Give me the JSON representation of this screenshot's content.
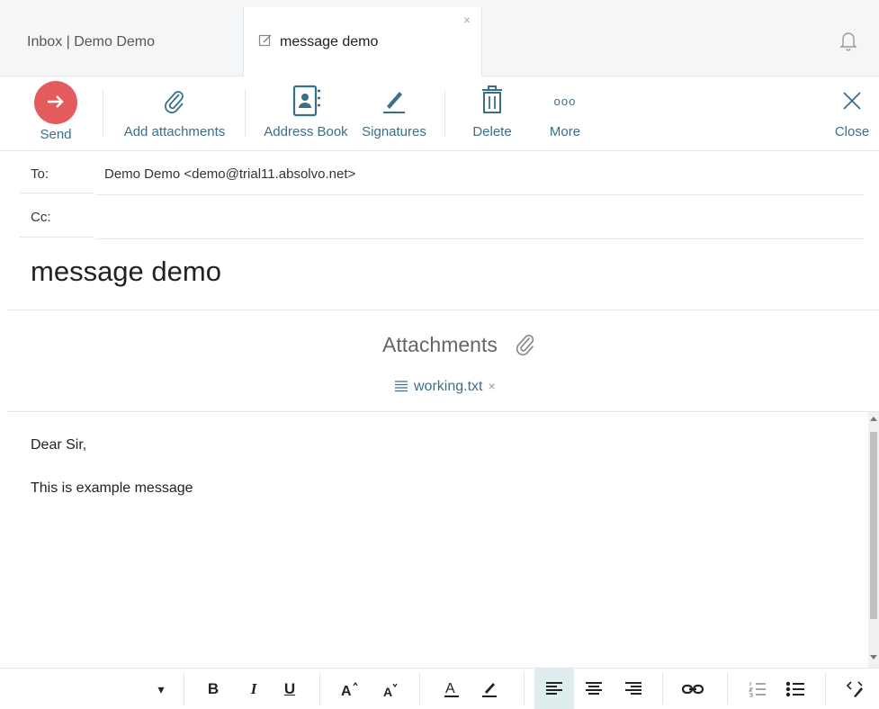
{
  "tabs": {
    "inbox_label": "Inbox | Demo Demo",
    "compose_label": "message demo",
    "close_glyph": "×"
  },
  "toolbar": {
    "send": "Send",
    "add_attachments": "Add attachments",
    "address_book": "Address Book",
    "signatures": "Signatures",
    "delete": "Delete",
    "more": "More",
    "close": "Close",
    "more_glyph": "ooo"
  },
  "fields": {
    "to_label": "To:",
    "to_value": "Demo Demo <demo@trial11.absolvo.net>",
    "cc_label": "Cc:",
    "cc_value": ""
  },
  "subject": "message demo",
  "attachments": {
    "title": "Attachments",
    "file_name": "working.txt",
    "remove_glyph": "×"
  },
  "body": {
    "line1": "Dear Sir,",
    "line2": "This is example message"
  },
  "format_bar": {
    "dropdown": "▾",
    "bold": "B",
    "italic": "I",
    "underline": "U"
  },
  "colors": {
    "accent": "#3a6f88",
    "send": "#e35b5d"
  }
}
